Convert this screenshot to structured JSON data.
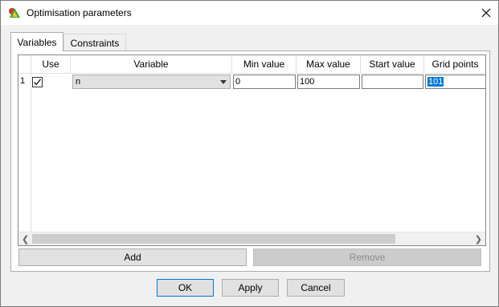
{
  "window": {
    "title": "Optimisation parameters"
  },
  "tabs": [
    {
      "label": "Variables",
      "active": true
    },
    {
      "label": "Constraints",
      "active": false
    }
  ],
  "grid": {
    "columns": [
      "Use",
      "Variable",
      "Min value",
      "Max value",
      "Start value",
      "Grid points"
    ],
    "rows": [
      {
        "row_number": "1",
        "use_checked": true,
        "variable": "n",
        "min_value": "0",
        "max_value": "100",
        "start_value": "",
        "grid_points": "101"
      }
    ]
  },
  "panel_buttons": {
    "add_label": "Add",
    "remove_label": "Remove"
  },
  "dialog_buttons": {
    "ok_label": "OK",
    "apply_label": "Apply",
    "cancel_label": "Cancel"
  },
  "icons": {
    "app": "optimisation-app-icon",
    "close": "close-icon",
    "checkbox": "checkmark-icon",
    "dropdown": "chevron-down-icon",
    "scroll_left": "arrow-left-icon",
    "scroll_right": "arrow-right-icon"
  },
  "colors": {
    "selection": "#0078d7",
    "default_button_border": "#0078d7"
  }
}
